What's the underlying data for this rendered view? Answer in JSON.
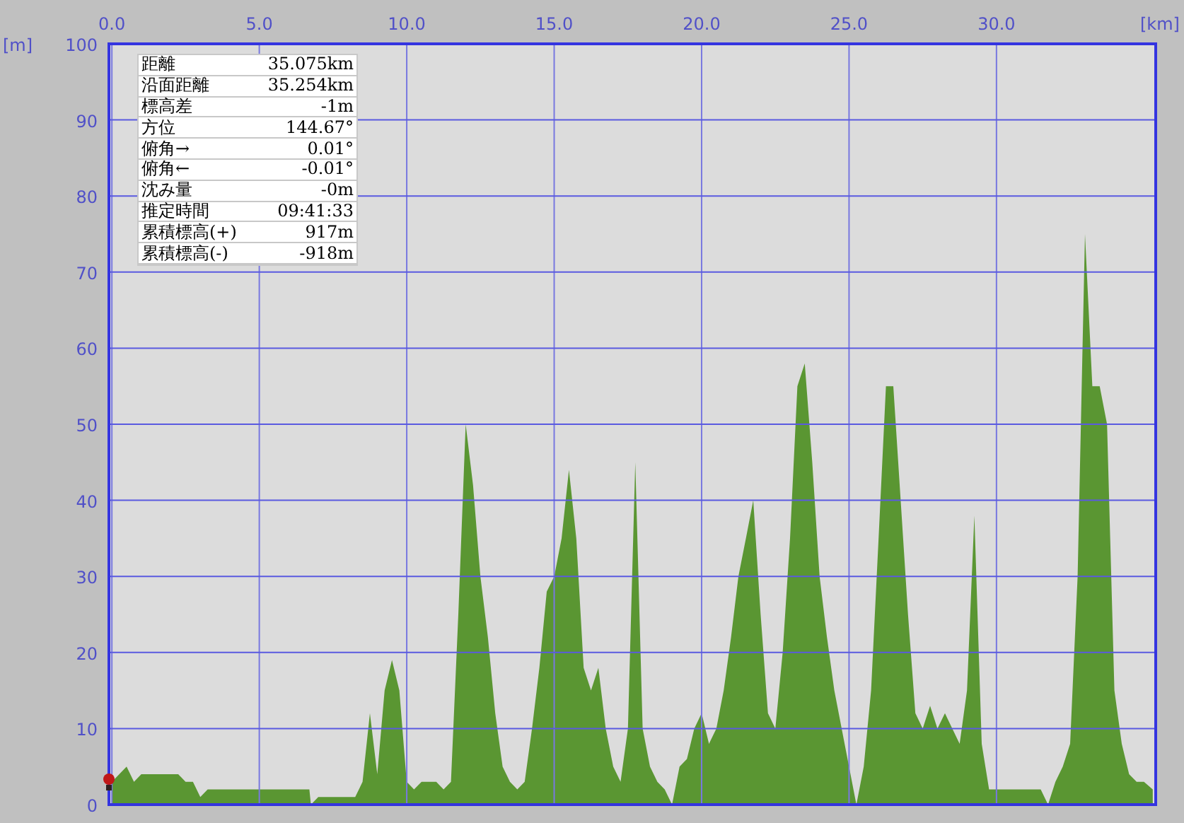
{
  "info_table": {
    "rows": [
      {
        "label": "距離",
        "value": "35.075km"
      },
      {
        "label": "沿面距離",
        "value": "35.254km"
      },
      {
        "label": "標高差",
        "value": "-1m"
      },
      {
        "label": "方位",
        "value": "144.67°"
      },
      {
        "label": "俯角→",
        "value": "0.01°"
      },
      {
        "label": "俯角←",
        "value": "-0.01°"
      },
      {
        "label": "沈み量",
        "value": "-0m"
      },
      {
        "label": "推定時間",
        "value": "09:41:33"
      },
      {
        "label": "累積標高(+)",
        "value": "917m"
      },
      {
        "label": "累積標高(-)",
        "value": "-918m"
      }
    ]
  },
  "profile": {
    "chart_data": {
      "type": "area",
      "grid": true,
      "xlabel": "[km]",
      "ylabel": "[m]",
      "x": [
        0,
        0.25,
        0.5,
        0.75,
        1,
        1.25,
        1.5,
        1.75,
        2,
        2.25,
        2.5,
        2.75,
        3,
        3.25,
        3.5,
        3.75,
        4,
        4.5,
        5,
        5.5,
        6,
        6.5,
        6.7,
        6.75,
        7,
        7.5,
        8,
        8.25,
        8.5,
        8.75,
        9,
        9.25,
        9.5,
        9.75,
        10,
        10.25,
        10.5,
        11,
        11.25,
        11.5,
        11.75,
        12,
        12.25,
        12.5,
        12.75,
        13,
        13.25,
        13.5,
        13.75,
        14,
        14.25,
        14.5,
        14.75,
        15,
        15.25,
        15.5,
        15.75,
        16,
        16.25,
        16.5,
        16.75,
        17,
        17.25,
        17.5,
        17.75,
        18,
        18.25,
        18.5,
        18.75,
        19,
        19.25,
        19.5,
        19.75,
        20,
        20.25,
        20.5,
        20.75,
        21,
        21.25,
        21.5,
        21.75,
        22,
        22.25,
        22.5,
        22.75,
        23,
        23.25,
        23.5,
        23.75,
        24,
        24.25,
        24.5,
        24.75,
        25,
        25.25,
        25.5,
        25.75,
        26,
        26.25,
        26.5,
        26.75,
        27,
        27.25,
        27.5,
        27.75,
        28,
        28.25,
        28.5,
        28.75,
        29,
        29.25,
        29.5,
        29.75,
        30,
        30.5,
        31,
        31.5,
        31.75,
        32,
        32.25,
        32.5,
        32.75,
        33,
        33.25,
        33.5,
        33.75,
        34,
        34.25,
        34.5,
        34.75,
        35,
        35.3
      ],
      "series": [
        {
          "color": "#5a9632",
          "values": [
            3,
            4,
            5,
            3,
            4,
            4,
            4,
            4,
            4,
            4,
            3,
            3,
            1,
            2,
            2,
            2,
            2,
            2,
            2,
            2,
            2,
            2,
            2,
            0,
            1,
            1,
            1,
            1,
            3,
            12,
            4,
            15,
            19,
            15,
            3,
            2,
            3,
            3,
            2,
            3,
            25,
            50,
            42,
            30,
            22,
            12,
            5,
            3,
            2,
            3,
            10,
            18,
            28,
            30,
            35,
            44,
            35,
            18,
            15,
            18,
            10,
            5,
            3,
            10,
            45,
            10,
            5,
            3,
            2,
            0,
            5,
            6,
            10,
            12,
            8,
            10,
            15,
            22,
            30,
            35,
            40,
            25,
            12,
            10,
            20,
            35,
            55,
            58,
            45,
            30,
            22,
            15,
            10,
            5,
            0,
            5,
            15,
            35,
            55,
            55,
            40,
            25,
            12,
            10,
            13,
            10,
            12,
            10,
            8,
            15,
            38,
            8,
            2,
            2,
            2,
            2,
            2,
            0,
            3,
            5,
            8,
            30,
            75,
            55,
            55,
            50,
            15,
            8,
            4,
            3,
            3,
            2
          ]
        }
      ],
      "xlim": [
        -0.1,
        35.4
      ],
      "ylim": [
        0,
        100
      ],
      "xticks": [
        {
          "value": 0,
          "label": "0.0"
        },
        {
          "value": 5,
          "label": "5.0"
        },
        {
          "value": 10,
          "label": "10.0"
        },
        {
          "value": 15,
          "label": "15.0"
        },
        {
          "value": 20,
          "label": "20.0"
        },
        {
          "value": 25,
          "label": "25.0"
        },
        {
          "value": 30,
          "label": "30.0"
        }
      ],
      "yticks": [
        0,
        10,
        20,
        30,
        40,
        50,
        60,
        70,
        80,
        90,
        100
      ]
    }
  }
}
